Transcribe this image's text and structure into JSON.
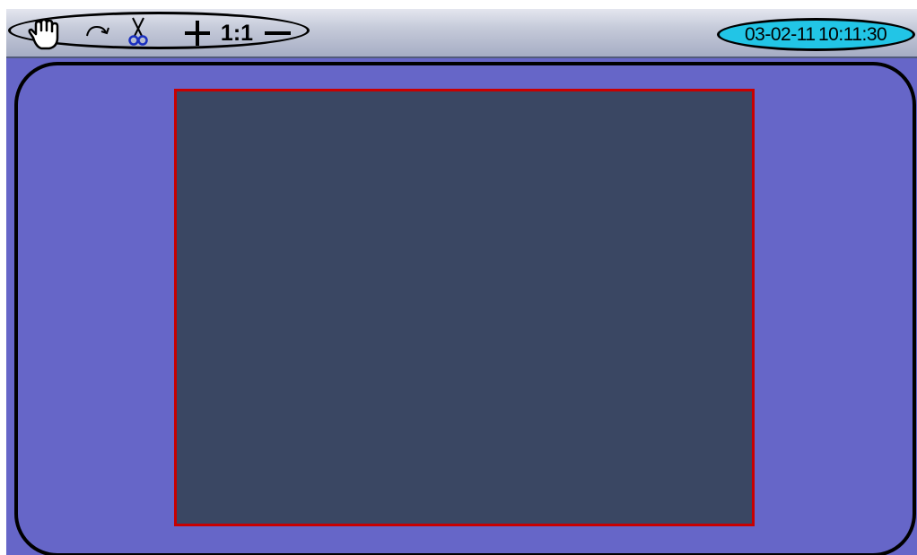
{
  "toolbar": {
    "tools": [
      {
        "name": "hand-icon"
      },
      {
        "name": "rotate-icon"
      },
      {
        "name": "scissors-icon"
      },
      {
        "name": "zoom-in-icon"
      },
      {
        "name": "zoom-reset",
        "label": "1:1"
      },
      {
        "name": "zoom-out-icon"
      }
    ]
  },
  "clock": {
    "date": "03-02-11",
    "time": "10:11:30"
  },
  "colors": {
    "background": "#6666c8",
    "clock_background": "#22c5e6",
    "video_area": "#3a4763",
    "selection_border": "#c80000",
    "highlight_outline": "#000000"
  }
}
